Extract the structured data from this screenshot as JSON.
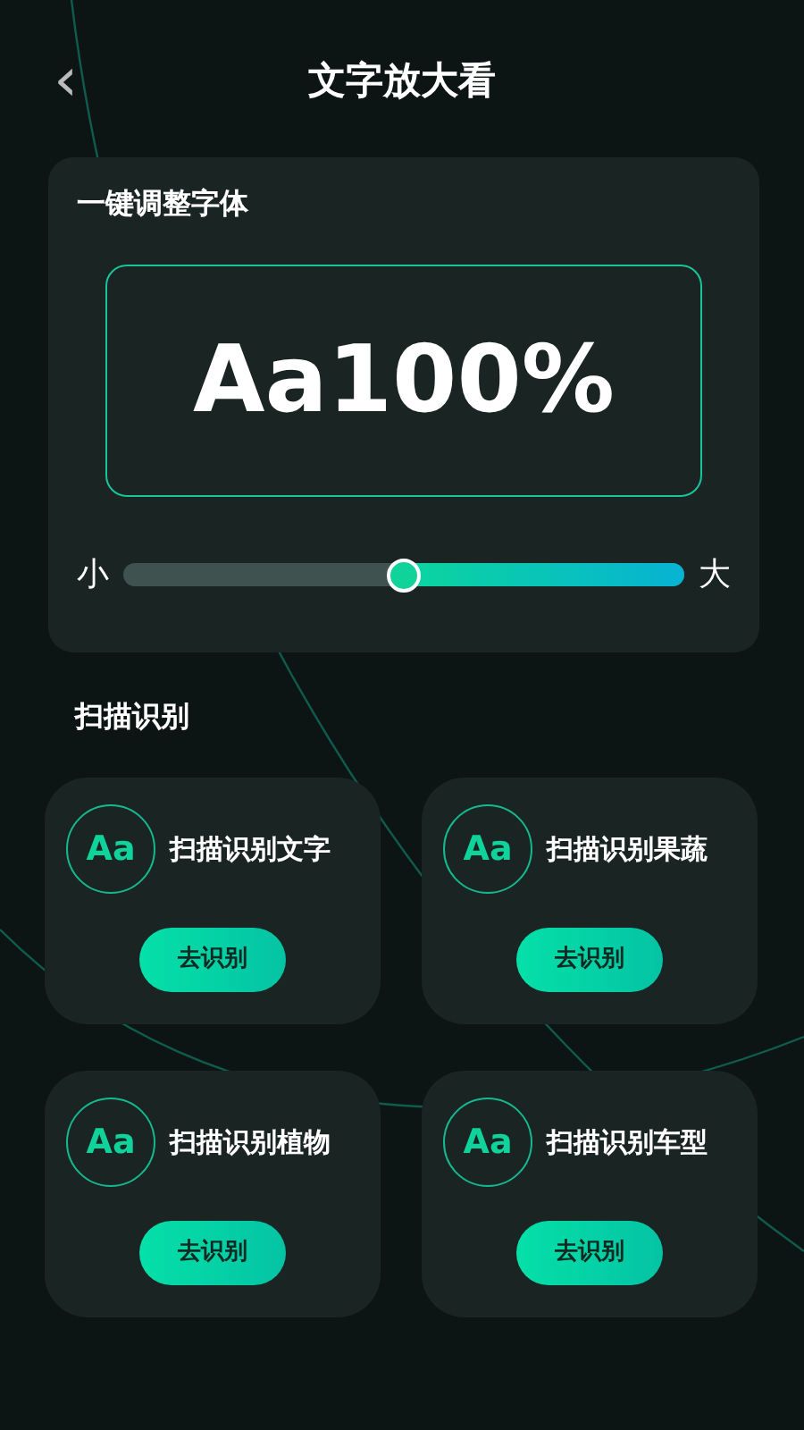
{
  "header": {
    "back": "‹",
    "title": "文字放大看"
  },
  "adjust": {
    "title": "一键调整字体",
    "preview": "Aa100%",
    "slider": {
      "min_label": "小",
      "max_label": "大",
      "level": 0.5
    }
  },
  "scan": {
    "title": "扫描识别",
    "items": [
      {
        "icon": "Aa",
        "label": "扫描识别文字",
        "button": "去识别"
      },
      {
        "icon": "Aa",
        "label": "扫描识别果蔬",
        "button": "去识别"
      },
      {
        "icon": "Aa",
        "label": "扫描识别植物",
        "button": "去识别"
      },
      {
        "icon": "Aa",
        "label": "扫描识别车型",
        "button": "去识别"
      }
    ]
  }
}
